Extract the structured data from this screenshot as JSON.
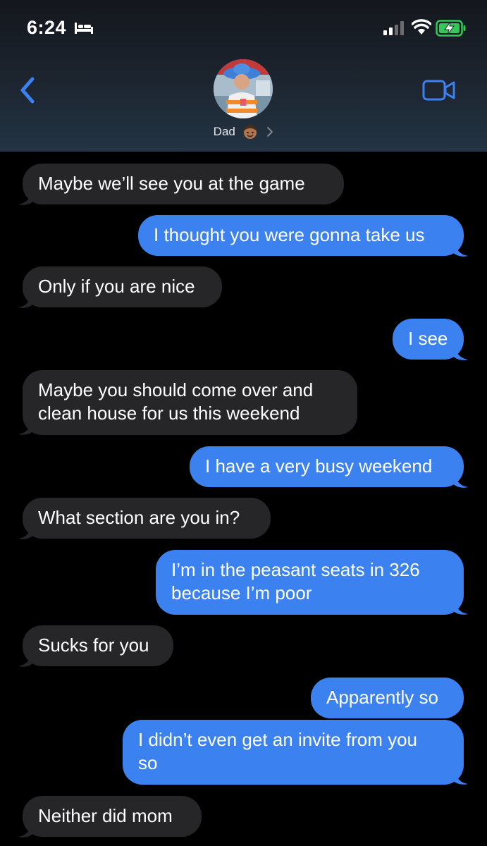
{
  "status_bar": {
    "time": "6:24",
    "sleep_icon": "bed-icon",
    "signal_icon": "cellular-signal-icon",
    "wifi_icon": "wifi-icon",
    "battery_icon": "battery-charging-icon",
    "battery_color": "#34c759"
  },
  "header": {
    "back_icon": "chevron-left-icon",
    "contact_name": "Dad",
    "contact_emoji": "man-emoji",
    "detail_icon": "chevron-right-icon",
    "video_icon": "video-camera-icon",
    "accent_color": "#3b82f0"
  },
  "messages": [
    {
      "side": "in",
      "lines": [
        "Maybe we’ll see you at the game"
      ]
    },
    {
      "side": "out",
      "lines": [
        "I thought you were gonna take us"
      ]
    },
    {
      "side": "in",
      "lines": [
        "Only if you are nice"
      ]
    },
    {
      "side": "out",
      "lines": [
        "I see"
      ]
    },
    {
      "side": "in",
      "lines": [
        "Maybe you should come over and",
        "clean house for us this weekend"
      ]
    },
    {
      "side": "out",
      "lines": [
        "I have a very busy weekend"
      ]
    },
    {
      "side": "in",
      "lines": [
        "What section are you in?"
      ]
    },
    {
      "side": "out",
      "lines": [
        "I’m in the peasant seats in 326",
        "because I’m poor"
      ]
    },
    {
      "side": "in",
      "lines": [
        "Sucks for you"
      ]
    },
    {
      "side": "out",
      "lines": [
        "Apparently so"
      ]
    },
    {
      "side": "out",
      "lines": [
        "I didn’t even get an invite from you",
        "so"
      ]
    },
    {
      "side": "in",
      "lines": [
        "Neither did mom"
      ]
    }
  ],
  "colors": {
    "incoming_bubble": "#262628",
    "outgoing_bubble": "#3b82f0",
    "background": "#000000"
  }
}
